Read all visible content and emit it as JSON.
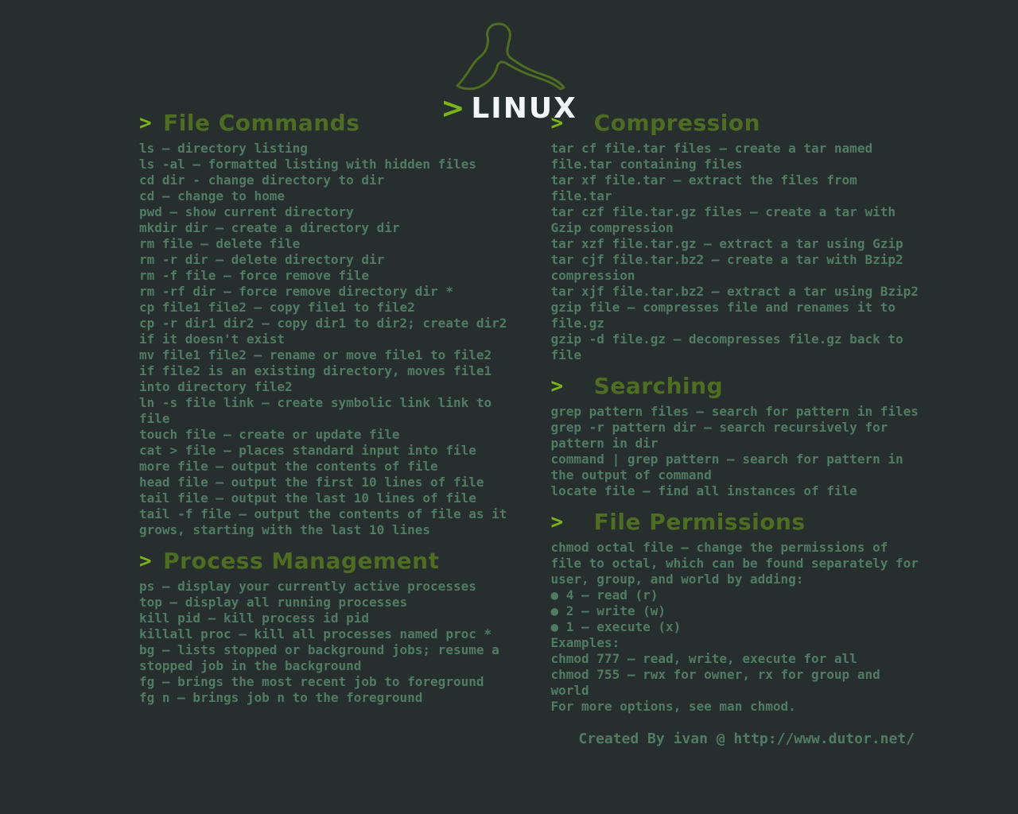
{
  "logo": {
    "prompt": ">",
    "text": "LINUX"
  },
  "left": {
    "sections": [
      {
        "title": "File Commands",
        "body": "ls – directory listing\nls -al – formatted listing with hidden files\ncd dir - change directory to dir\ncd – change to home\npwd – show current directory\nmkdir dir – create a directory dir\nrm file – delete file\nrm -r dir – delete directory dir\nrm -f file – force remove file\nrm -rf dir – force remove directory dir *\ncp file1 file2 – copy file1 to file2\ncp -r dir1 dir2 – copy dir1 to dir2; create dir2 if it doesn't exist\nmv file1 file2 – rename or move file1 to file2\nif file2 is an existing directory, moves file1 into directory file2\nln -s file link – create symbolic link link to file\ntouch file – create or update file\ncat > file – places standard input into file\nmore file – output the contents of file\nhead file – output the first 10 lines of file\ntail file – output the last 10 lines of file\ntail -f file – output the contents of file as it grows, starting with the last 10 lines"
      },
      {
        "title": "Process Management",
        "body": "ps – display your currently active processes\ntop – display all running processes\nkill pid – kill process id pid\nkillall proc – kill all processes named proc *\nbg – lists stopped or background jobs; resume a stopped job in the background\nfg – brings the most recent job to foreground\nfg n – brings job n to the foreground"
      }
    ]
  },
  "right": {
    "sections": [
      {
        "title": "Compression",
        "body": "tar cf file.tar files – create a tar named file.tar containing files\ntar xf file.tar – extract the files from file.tar\ntar czf file.tar.gz files – create a tar with Gzip compression\ntar xzf file.tar.gz – extract a tar using Gzip\ntar cjf file.tar.bz2 – create a tar with Bzip2 compression\ntar xjf file.tar.bz2 – extract a tar using Bzip2\ngzip file – compresses file and renames it to file.gz\ngzip -d file.gz – decompresses file.gz back to file"
      },
      {
        "title": "Searching",
        "body": "grep pattern files – search for pattern in files\ngrep -r pattern dir – search recursively for pattern in dir\ncommand | grep pattern – search for pattern in the output of command\nlocate file – find all instances of file"
      },
      {
        "title": "File Permissions",
        "body": "chmod octal file – change the permissions of file to octal, which can be found separately for user, group, and world by adding:\n● 4 – read (r)\n● 2 – write (w)\n● 1 – execute (x)\nExamples:\nchmod 777 – read, write, execute for all\nchmod 755 – rwx for owner, rx for group and world\nFor more options, see man chmod."
      }
    ]
  },
  "footer": "Created By ivan @ http://www.dutor.net/"
}
